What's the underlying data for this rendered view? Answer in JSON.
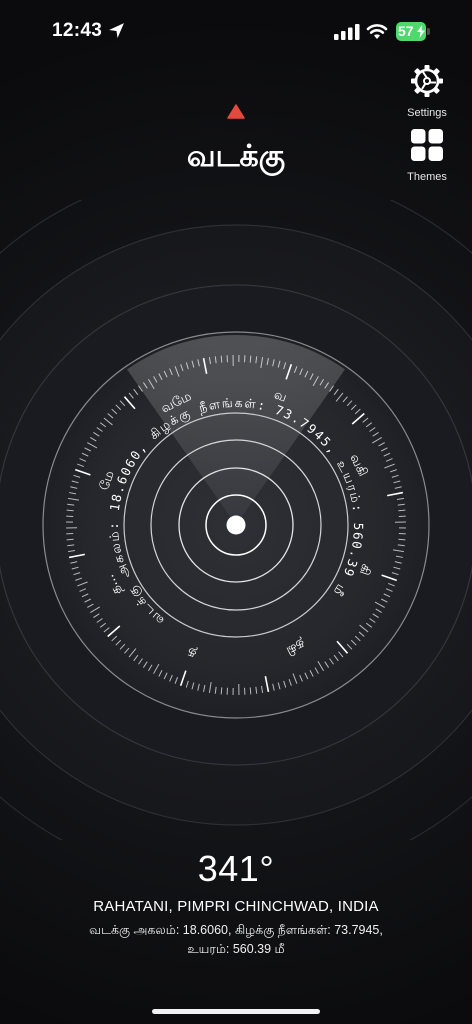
{
  "status": {
    "time": "12:43",
    "battery": "57"
  },
  "toolbar": {
    "settings_label": "Settings",
    "themes_label": "Themes"
  },
  "compass": {
    "direction_word": "வடக்கு",
    "dial_text": "வடக்கு அகலம்: 18.6060, கிழக்கு நீளங்கள்: 73.7945, உயரம்: 560.39 மீ",
    "dial_labels": [
      "வ",
      "வகி",
      "கி",
      "தகி",
      "த",
      "த...",
      "மே",
      "வமே"
    ],
    "heading_degrees": 341,
    "accent_color": "#e5483d"
  },
  "location": {
    "heading_display": "341°",
    "place": "RAHATANI, PIMPRI CHINCHWAD, INDIA",
    "coords_line1": "வடக்கு அகலம்: 18.6060, கிழக்கு நீளங்கள்: 73.7945,",
    "coords_line2": "உயரம்: 560.39 மீ"
  }
}
